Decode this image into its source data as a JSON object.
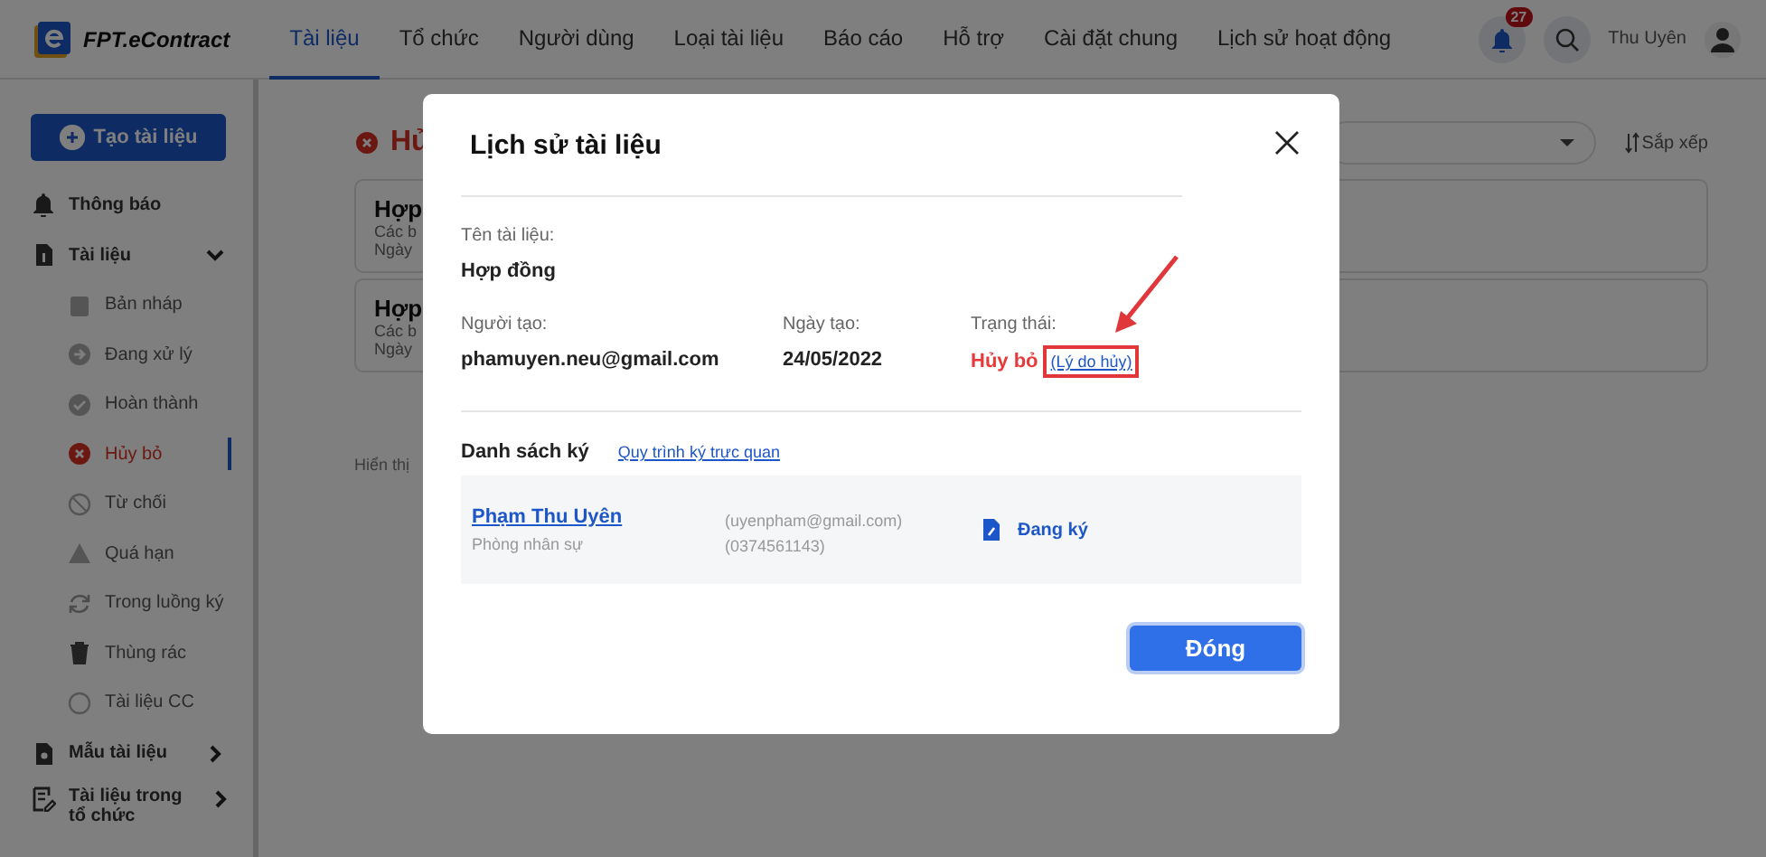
{
  "app": {
    "logo": "FPT.eContract"
  },
  "nav": [
    {
      "label": "Tài liệu",
      "selected": true
    },
    {
      "label": "Tổ chức",
      "selected": false
    },
    {
      "label": "Người dùng",
      "selected": false
    },
    {
      "label": "Loại tài liệu",
      "selected": false
    },
    {
      "label": "Báo cáo",
      "selected": false
    },
    {
      "label": "Hỗ trợ",
      "selected": false
    },
    {
      "label": "Cài đặt chung",
      "selected": false
    },
    {
      "label": "Lịch sử hoạt động",
      "selected": false
    }
  ],
  "notifications": {
    "count": "27"
  },
  "user": {
    "name": "Thu Uyên"
  },
  "sidebar": {
    "create_button": "Tạo tài liệu",
    "items": [
      {
        "label": "Thông báo",
        "kind": "bell"
      },
      {
        "label": "Tài liệu",
        "kind": "doc",
        "expanded": true,
        "children": [
          {
            "label": "Bản nháp",
            "kind": "draft",
            "selected": false
          },
          {
            "label": "Đang xử lý",
            "kind": "processing",
            "selected": false
          },
          {
            "label": "Hoàn thành",
            "kind": "done",
            "selected": false
          },
          {
            "label": "Hủy bỏ",
            "kind": "cancel",
            "selected": true
          },
          {
            "label": "Từ chối",
            "kind": "reject",
            "selected": false
          },
          {
            "label": "Quá hạn",
            "kind": "overdue",
            "selected": false
          },
          {
            "label": "Trong luồng ký",
            "kind": "flow",
            "selected": false
          },
          {
            "label": "Thùng rác",
            "kind": "trash",
            "selected": false
          },
          {
            "label": "Tài liệu CC",
            "kind": "cc",
            "selected": false
          }
        ]
      },
      {
        "label": "Mẫu tài liệu",
        "kind": "template",
        "expanded": false
      },
      {
        "label": "Tài liệu trong tổ chức",
        "kind": "org",
        "expanded": false
      }
    ]
  },
  "content": {
    "title": "Hủ",
    "sort": "Sắp xếp",
    "cards": [
      {
        "title": "Hợp",
        "line_1": "Các b",
        "line_2": "Ngày"
      },
      {
        "title": "Hợp",
        "line_1": "Các b",
        "line_2": "Ngày"
      }
    ],
    "footer": "Hiển thị"
  },
  "modal": {
    "title": "Lịch sử tài liệu",
    "name_label": "Tên tài liệu:",
    "name": "Hợp đồng",
    "creator_label": "Người tạo:",
    "creator": "phamuyen.neu@gmail.com",
    "date_label": "Ngày tạo:",
    "date": "24/05/2022",
    "status_label": "Trạng thái:",
    "status": "Hủy bỏ",
    "reason_link": "(Lý do hủy)",
    "signers_title": "Danh sách ký",
    "workflow_link": "Quy trình ký trực quan",
    "signers": [
      {
        "name": "Phạm Thu Uyên",
        "department": "Phòng nhân sự",
        "email": "(uyenpham@gmail.com)",
        "phone": "(0374561143)",
        "status": "Đang ký"
      }
    ],
    "close_button": "Đóng"
  }
}
